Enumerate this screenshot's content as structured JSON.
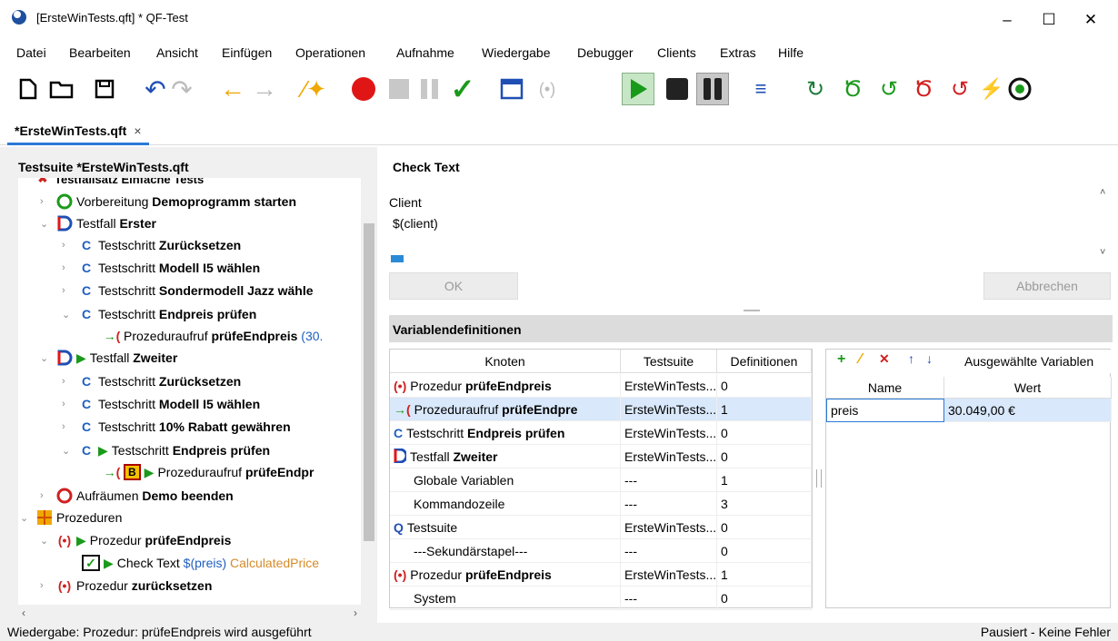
{
  "window": {
    "title": "[ErsteWinTests.qft] * QF-Test",
    "min": "–",
    "max": "☐",
    "close": "✕"
  },
  "menu": [
    "Datei",
    "Bearbeiten",
    "Ansicht",
    "Einfügen",
    "Operationen",
    "Aufnahme",
    "Wiedergabe",
    "Debugger",
    "Clients",
    "Extras",
    "Hilfe"
  ],
  "tab": {
    "label": "*ErsteWinTests.qft",
    "close": "×"
  },
  "tree": {
    "header": "Testsuite *ErsteWinTests.qft",
    "top_fragment": "Testfallsatz Einfache Tests",
    "nodes": [
      {
        "prefix": "Vorbereitung",
        "name": "Demoprogramm starten"
      },
      {
        "prefix": "Testfall",
        "name": "Erster"
      },
      {
        "prefix": "Testschritt",
        "name": "Zurücksetzen"
      },
      {
        "prefix": "Testschritt",
        "name": "Modell I5 wählen"
      },
      {
        "prefix": "Testschritt",
        "name": "Sondermodell Jazz wähle"
      },
      {
        "prefix": "Testschritt",
        "name": "Endpreis prüfen"
      },
      {
        "prefix": "Prozeduraufruf",
        "name": "prüfeEndpreis",
        "extra": "(30."
      },
      {
        "prefix": "Testfall",
        "name": "Zweiter"
      },
      {
        "prefix": "Testschritt",
        "name": "Zurücksetzen"
      },
      {
        "prefix": "Testschritt",
        "name": "Modell I5 wählen"
      },
      {
        "prefix": "Testschritt",
        "name": "10% Rabatt gewähren"
      },
      {
        "prefix": "Testschritt",
        "name": "Endpreis prüfen"
      },
      {
        "prefix": "Prozeduraufruf",
        "name": "prüfeEndpr"
      },
      {
        "prefix": "Aufräumen",
        "name": "Demo beenden"
      },
      {
        "prefix": "Prozeduren",
        "name": ""
      },
      {
        "prefix": "Prozedur",
        "name": "prüfeEndpreis"
      },
      {
        "prefix": "Check Text",
        "name": "$(preis)",
        "extra": "CalculatedPrice"
      },
      {
        "prefix": "Prozedur",
        "name": "zurücksetzen"
      }
    ]
  },
  "detail": {
    "title": "Check Text",
    "client_label": "Client",
    "client_value": "$(client)",
    "ok": "OK",
    "cancel": "Abbrechen"
  },
  "variables": {
    "header": "Variablendefinitionen",
    "columns": [
      "Knoten",
      "Testsuite",
      "Definitionen"
    ],
    "rows": [
      {
        "prefix": "Prozedur",
        "bold": "prüfeEndpreis",
        "suite": "ErsteWinTests....",
        "defs": "0"
      },
      {
        "prefix": "Prozeduraufruf",
        "bold": "prüfeEndpre",
        "suite": "ErsteWinTests....",
        "defs": "1"
      },
      {
        "prefix": "Testschritt",
        "bold": "Endpreis prüfen",
        "suite": "ErsteWinTests....",
        "defs": "0"
      },
      {
        "prefix": "Testfall",
        "bold": "Zweiter",
        "suite": "ErsteWinTests....",
        "defs": "0"
      },
      {
        "prefix": "Globale Variablen",
        "bold": "",
        "suite": "---",
        "defs": "1"
      },
      {
        "prefix": "Kommandozeile",
        "bold": "",
        "suite": "---",
        "defs": "3"
      },
      {
        "prefix": "Testsuite",
        "bold": "",
        "suite": "ErsteWinTests....",
        "defs": "0"
      },
      {
        "prefix": "---Sekundärstapel---",
        "bold": "",
        "suite": "---",
        "defs": "0"
      },
      {
        "prefix": "Prozedur",
        "bold": "prüfeEndpreis",
        "suite": "ErsteWinTests....",
        "defs": "1"
      },
      {
        "prefix": "System",
        "bold": "",
        "suite": "---",
        "defs": "0"
      }
    ],
    "selected_label": "Ausgewählte Variablen",
    "sel_columns": [
      "Name",
      "Wert"
    ],
    "sel_rows": [
      {
        "name": "preis",
        "value": "30.049,00 €"
      }
    ]
  },
  "status": {
    "left": "Wiedergabe: Prozedur: prüfeEndpreis wird ausgeführt",
    "right": "Pausiert - Keine Fehler"
  },
  "colors": {
    "accent": "#2a7ad5",
    "red": "#e01616",
    "green": "#1a9a1a",
    "orange": "#f0a800",
    "selection": "#d9e8fb"
  }
}
